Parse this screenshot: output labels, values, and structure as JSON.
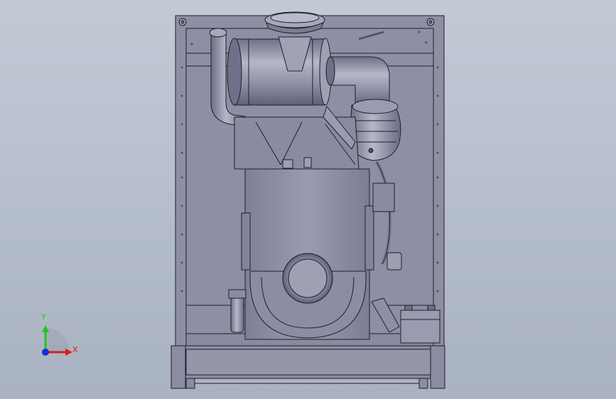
{
  "viewport": {
    "background_top": "#c2cad6",
    "background_bottom": "#a9b2c2",
    "model_color": "#8f90a5",
    "edge_color": "#1e1f2a"
  },
  "triad": {
    "y_label": "Y",
    "x_label": "X",
    "y_color": "#1ec81e",
    "x_color": "#e01b1b",
    "z_color": "#1b2be0"
  }
}
